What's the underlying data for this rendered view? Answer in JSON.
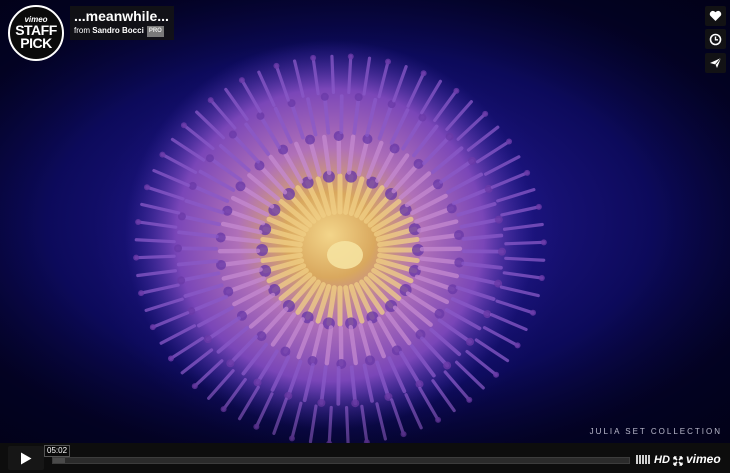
{
  "video": {
    "title": "...meanwhile...",
    "byline_prefix": "from",
    "author": "Sandro Bocci",
    "author_badge": "PRO",
    "watermark": "JULIA SET COLLECTION"
  },
  "badge": {
    "brand": "vimeo",
    "line1": "STAFF",
    "line2": "PICK"
  },
  "side_buttons": {
    "like_icon": "heart-icon",
    "later_icon": "clock-icon",
    "share_icon": "paper-plane-icon"
  },
  "controls": {
    "play_icon": "play-icon",
    "time": "05:02",
    "loaded_fraction": 0.02,
    "hd_label": "HD",
    "fullscreen_icon": "fullscreen-icon",
    "brand": "vimeo"
  },
  "colors": {
    "background": "#0c0a5a",
    "coral_outer": "#6a3fb0",
    "coral_inner": "#d9b46a"
  }
}
